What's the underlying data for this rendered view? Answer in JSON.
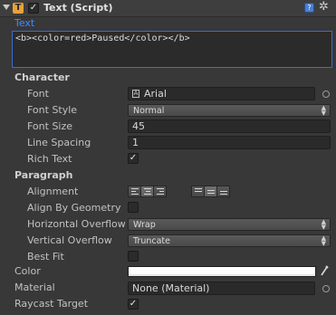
{
  "header": {
    "title": "Text (Script)",
    "enabled": true
  },
  "text_area": {
    "label": "Text",
    "value": "<b><color=red>Paused</color></b>"
  },
  "character": {
    "heading": "Character",
    "font_label": "Font",
    "font_value": "Arial",
    "font_style_label": "Font Style",
    "font_style_value": "Normal",
    "font_size_label": "Font Size",
    "font_size_value": "45",
    "line_spacing_label": "Line Spacing",
    "line_spacing_value": "1",
    "rich_text_label": "Rich Text",
    "rich_text_checked": true
  },
  "paragraph": {
    "heading": "Paragraph",
    "alignment_label": "Alignment",
    "align_by_geometry_label": "Align By Geometry",
    "align_by_geometry_checked": false,
    "horizontal_overflow_label": "Horizontal Overflow",
    "horizontal_overflow_value": "Wrap",
    "vertical_overflow_label": "Vertical Overflow",
    "vertical_overflow_value": "Truncate",
    "best_fit_label": "Best Fit",
    "best_fit_checked": false
  },
  "color": {
    "label": "Color",
    "value": "#ffffff"
  },
  "material": {
    "label": "Material",
    "value": "None (Material)"
  },
  "raycast": {
    "label": "Raycast Target",
    "checked": true
  },
  "icons": {
    "check_glyph": "✓",
    "gear_glyph": "✲"
  },
  "colors": {
    "background": "#383838",
    "accent_label": "#3f8cff",
    "text_area_border": "#3f6ccf"
  }
}
